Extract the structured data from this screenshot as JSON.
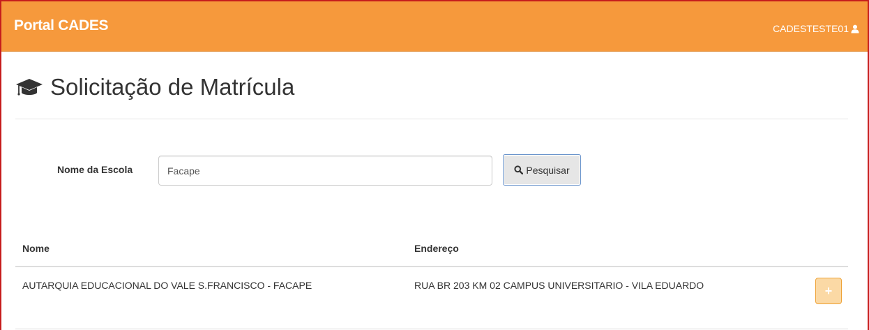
{
  "navbar": {
    "brand": "Portal CADES",
    "username": "CADESTESTE01",
    "user_icon": "user-icon",
    "background_color": "#f6993c"
  },
  "page": {
    "title": "Solicitação de Matrícula",
    "title_icon": "graduation-cap-icon"
  },
  "search": {
    "label": "Nome da Escola",
    "value": "Facape",
    "button_label": "Pesquisar",
    "button_icon": "search-icon"
  },
  "table": {
    "columns": [
      "Nome",
      "Endereço"
    ],
    "rows": [
      {
        "nome": "AUTARQUIA EDUCACIONAL DO VALE S.FRANCISCO - FACAPE",
        "endereco": "RUA BR 203 KM 02 CAMPUS UNIVERSITARIO - VILA EDUARDO",
        "action_label": "+",
        "action_icon": "plus-icon"
      }
    ]
  }
}
